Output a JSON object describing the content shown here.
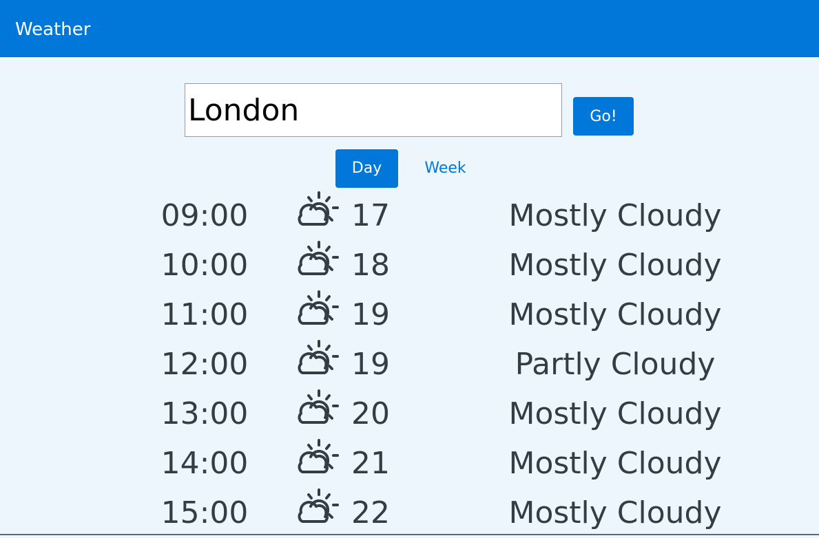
{
  "header": {
    "title": "Weather"
  },
  "search": {
    "value": "London",
    "button_label": "Go!"
  },
  "tabs": [
    {
      "label": "Day",
      "active": true
    },
    {
      "label": "Week",
      "active": false
    }
  ],
  "colors": {
    "accent": "#0077d9",
    "background": "#eef6fd",
    "text": "#343c46"
  },
  "forecast": [
    {
      "time": "09:00",
      "icon": "partly-cloudy-icon",
      "temp": "17",
      "condition": "Mostly Cloudy"
    },
    {
      "time": "10:00",
      "icon": "partly-cloudy-icon",
      "temp": "18",
      "condition": "Mostly Cloudy"
    },
    {
      "time": "11:00",
      "icon": "partly-cloudy-icon",
      "temp": "19",
      "condition": "Mostly Cloudy"
    },
    {
      "time": "12:00",
      "icon": "partly-cloudy-icon",
      "temp": "19",
      "condition": "Partly Cloudy"
    },
    {
      "time": "13:00",
      "icon": "partly-cloudy-icon",
      "temp": "20",
      "condition": "Mostly Cloudy"
    },
    {
      "time": "14:00",
      "icon": "partly-cloudy-icon",
      "temp": "21",
      "condition": "Mostly Cloudy"
    },
    {
      "time": "15:00",
      "icon": "partly-cloudy-icon",
      "temp": "22",
      "condition": "Mostly Cloudy"
    }
  ]
}
